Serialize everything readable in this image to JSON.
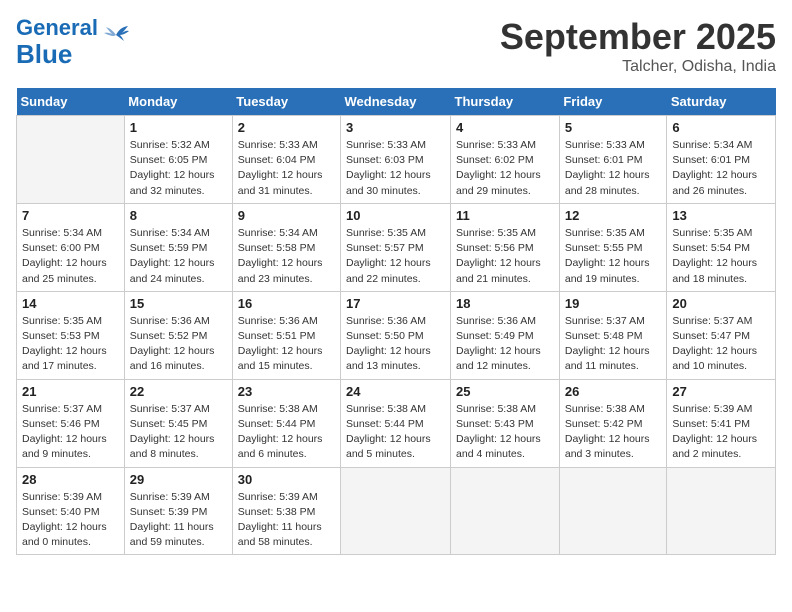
{
  "logo": {
    "general": "General",
    "blue": "Blue"
  },
  "header": {
    "month": "September 2025",
    "location": "Talcher, Odisha, India"
  },
  "days_of_week": [
    "Sunday",
    "Monday",
    "Tuesday",
    "Wednesday",
    "Thursday",
    "Friday",
    "Saturday"
  ],
  "weeks": [
    [
      {
        "num": "",
        "info": ""
      },
      {
        "num": "1",
        "info": "Sunrise: 5:32 AM\nSunset: 6:05 PM\nDaylight: 12 hours\nand 32 minutes."
      },
      {
        "num": "2",
        "info": "Sunrise: 5:33 AM\nSunset: 6:04 PM\nDaylight: 12 hours\nand 31 minutes."
      },
      {
        "num": "3",
        "info": "Sunrise: 5:33 AM\nSunset: 6:03 PM\nDaylight: 12 hours\nand 30 minutes."
      },
      {
        "num": "4",
        "info": "Sunrise: 5:33 AM\nSunset: 6:02 PM\nDaylight: 12 hours\nand 29 minutes."
      },
      {
        "num": "5",
        "info": "Sunrise: 5:33 AM\nSunset: 6:01 PM\nDaylight: 12 hours\nand 28 minutes."
      },
      {
        "num": "6",
        "info": "Sunrise: 5:34 AM\nSunset: 6:01 PM\nDaylight: 12 hours\nand 26 minutes."
      }
    ],
    [
      {
        "num": "7",
        "info": "Sunrise: 5:34 AM\nSunset: 6:00 PM\nDaylight: 12 hours\nand 25 minutes."
      },
      {
        "num": "8",
        "info": "Sunrise: 5:34 AM\nSunset: 5:59 PM\nDaylight: 12 hours\nand 24 minutes."
      },
      {
        "num": "9",
        "info": "Sunrise: 5:34 AM\nSunset: 5:58 PM\nDaylight: 12 hours\nand 23 minutes."
      },
      {
        "num": "10",
        "info": "Sunrise: 5:35 AM\nSunset: 5:57 PM\nDaylight: 12 hours\nand 22 minutes."
      },
      {
        "num": "11",
        "info": "Sunrise: 5:35 AM\nSunset: 5:56 PM\nDaylight: 12 hours\nand 21 minutes."
      },
      {
        "num": "12",
        "info": "Sunrise: 5:35 AM\nSunset: 5:55 PM\nDaylight: 12 hours\nand 19 minutes."
      },
      {
        "num": "13",
        "info": "Sunrise: 5:35 AM\nSunset: 5:54 PM\nDaylight: 12 hours\nand 18 minutes."
      }
    ],
    [
      {
        "num": "14",
        "info": "Sunrise: 5:35 AM\nSunset: 5:53 PM\nDaylight: 12 hours\nand 17 minutes."
      },
      {
        "num": "15",
        "info": "Sunrise: 5:36 AM\nSunset: 5:52 PM\nDaylight: 12 hours\nand 16 minutes."
      },
      {
        "num": "16",
        "info": "Sunrise: 5:36 AM\nSunset: 5:51 PM\nDaylight: 12 hours\nand 15 minutes."
      },
      {
        "num": "17",
        "info": "Sunrise: 5:36 AM\nSunset: 5:50 PM\nDaylight: 12 hours\nand 13 minutes."
      },
      {
        "num": "18",
        "info": "Sunrise: 5:36 AM\nSunset: 5:49 PM\nDaylight: 12 hours\nand 12 minutes."
      },
      {
        "num": "19",
        "info": "Sunrise: 5:37 AM\nSunset: 5:48 PM\nDaylight: 12 hours\nand 11 minutes."
      },
      {
        "num": "20",
        "info": "Sunrise: 5:37 AM\nSunset: 5:47 PM\nDaylight: 12 hours\nand 10 minutes."
      }
    ],
    [
      {
        "num": "21",
        "info": "Sunrise: 5:37 AM\nSunset: 5:46 PM\nDaylight: 12 hours\nand 9 minutes."
      },
      {
        "num": "22",
        "info": "Sunrise: 5:37 AM\nSunset: 5:45 PM\nDaylight: 12 hours\nand 8 minutes."
      },
      {
        "num": "23",
        "info": "Sunrise: 5:38 AM\nSunset: 5:44 PM\nDaylight: 12 hours\nand 6 minutes."
      },
      {
        "num": "24",
        "info": "Sunrise: 5:38 AM\nSunset: 5:44 PM\nDaylight: 12 hours\nand 5 minutes."
      },
      {
        "num": "25",
        "info": "Sunrise: 5:38 AM\nSunset: 5:43 PM\nDaylight: 12 hours\nand 4 minutes."
      },
      {
        "num": "26",
        "info": "Sunrise: 5:38 AM\nSunset: 5:42 PM\nDaylight: 12 hours\nand 3 minutes."
      },
      {
        "num": "27",
        "info": "Sunrise: 5:39 AM\nSunset: 5:41 PM\nDaylight: 12 hours\nand 2 minutes."
      }
    ],
    [
      {
        "num": "28",
        "info": "Sunrise: 5:39 AM\nSunset: 5:40 PM\nDaylight: 12 hours\nand 0 minutes."
      },
      {
        "num": "29",
        "info": "Sunrise: 5:39 AM\nSunset: 5:39 PM\nDaylight: 11 hours\nand 59 minutes."
      },
      {
        "num": "30",
        "info": "Sunrise: 5:39 AM\nSunset: 5:38 PM\nDaylight: 11 hours\nand 58 minutes."
      },
      {
        "num": "",
        "info": ""
      },
      {
        "num": "",
        "info": ""
      },
      {
        "num": "",
        "info": ""
      },
      {
        "num": "",
        "info": ""
      }
    ]
  ]
}
